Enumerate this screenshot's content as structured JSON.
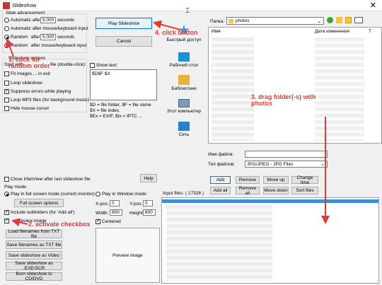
{
  "window": {
    "title": "Slideshow"
  },
  "advancement": {
    "legend": "Slide advancement",
    "opt_auto": "Automatic after",
    "opt_auto_value": "5.000",
    "seconds1": "seconds",
    "opt_auto_mouse": "Automatic after mouse/keyboard input",
    "opt_random": "Random",
    "opt_random_after": "after",
    "opt_random_value": "5.000",
    "seconds2": "seconds",
    "opt_random_mouse": "Random",
    "opt_random_mouse_rest": "after mouse/keyboard input"
  },
  "buttons": {
    "play": "Play Slideshow",
    "cancel": "Cancel",
    "help": "Help"
  },
  "options": {
    "legend": "Slideshow options",
    "start_with": "Start with",
    "file_double_click": "file (double-click):",
    "fit_images": "Fit images ... in exit",
    "loop": "Loop slideshow",
    "suppress": "Suppress errors while playing",
    "loop_mp3": "Loop MP3 files (for background music)",
    "hide_cursor": "Hide mouse cursor"
  },
  "show_text": {
    "label": "Show text:",
    "value": "$D$F $X",
    "help": "$D = file folder, $F = file name\n$X = file index,\n$Ex = EXIF, $Ix = IPTC ..."
  },
  "close_after": "Close IrfanView after last slideshow file",
  "play_mode": {
    "label": "Play mode:",
    "fullscreen": "Play in full screen mode (current monitor)",
    "window": "Play in Window mode:",
    "fullscreen_options": "Full screen options",
    "xpos_label": "X-pos:",
    "xpos": "0",
    "ypos_label": "Y-pos:",
    "ypos": "0",
    "width_label": "Width:",
    "width": "800",
    "height_label": "Height:",
    "height": "600",
    "centered": "Centered"
  },
  "include_subfolders": "Include subfolders (for 'Add all')",
  "preview_image_chk": "Preview image",
  "list_buttons": [
    "Load filenames from TXT file",
    "Save filenames as TXT file",
    "Save slideshow as Video",
    "Save slideshow as .EXE/SCR",
    "Burn slideshow to CD/DVD"
  ],
  "preview_placeholder": "Preview image",
  "browser": {
    "folder_label": "Папка:",
    "folder_value": "photos",
    "col_name": "Имя",
    "col_date": "Дата изменения",
    "col_t": "Т",
    "places": [
      {
        "label": "Быстрый доступ",
        "icon": "star-icon"
      },
      {
        "label": "Рабочий стол",
        "icon": "desktop-icon"
      },
      {
        "label": "Библиотеки",
        "icon": "library-icon"
      },
      {
        "label": "Этот компьютер",
        "icon": "computer-icon"
      },
      {
        "label": "Сеть",
        "icon": "network-icon"
      }
    ],
    "filename_label": "Имя файла:",
    "filetype_label": "Тип файлов:",
    "filetype_value": "JPG/JPEG - JPG Files"
  },
  "action_buttons": {
    "add": "Add",
    "remove": "Remove",
    "move_up": "Move up",
    "change_time": "Change time",
    "add_all": "Add all",
    "remove_all": "Remove all",
    "move_down": "Move down",
    "sort_files": "Sort files"
  },
  "input_files": {
    "label": "Input files:",
    "count": "( 17328 )"
  },
  "annotations": {
    "a1": "1. click for random order",
    "a2": "2. activate checkbox",
    "a3": "3. drag folder(-s) with photos",
    "a4": "4. click button"
  },
  "colors": {
    "annotation": "#e23a3a",
    "selection": "#3e8ee0"
  }
}
